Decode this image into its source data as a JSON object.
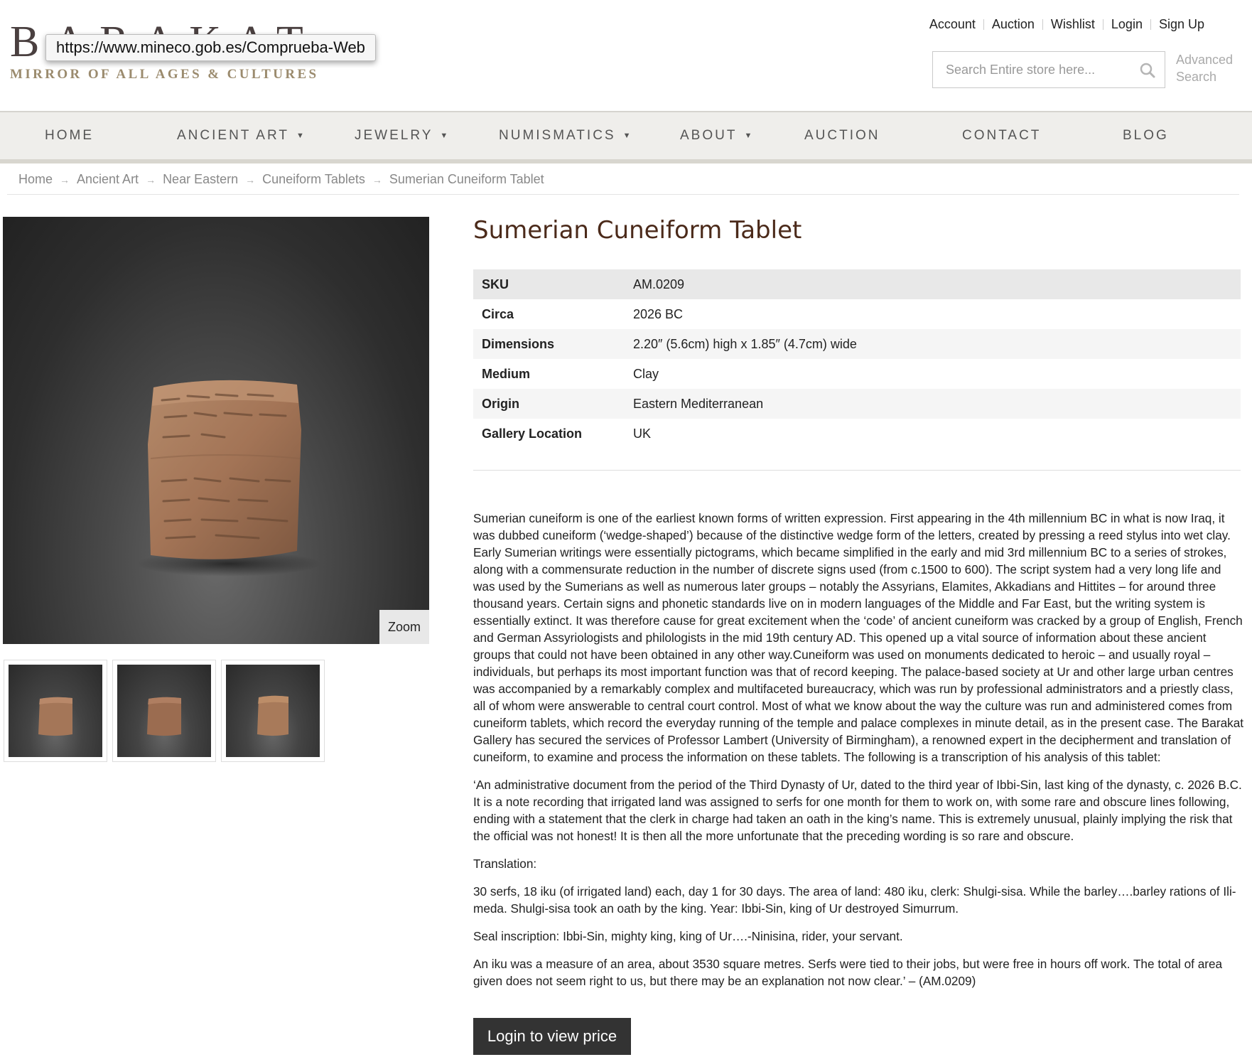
{
  "brand": {
    "name": "BARAKAT",
    "tagline": "MIRROR OF ALL AGES & CULTURES"
  },
  "url_tooltip": "https://www.mineco.gob.es/Comprueba-Web",
  "top_links": [
    "Account",
    "Auction",
    "Wishlist",
    "Login",
    "Sign Up"
  ],
  "search": {
    "placeholder": "Search Entire store here...",
    "advanced_line1": "Advanced",
    "advanced_line2": "Search"
  },
  "nav": [
    {
      "label": "HOME",
      "dropdown": false
    },
    {
      "label": "ANCIENT ART",
      "dropdown": true
    },
    {
      "label": "JEWELRY",
      "dropdown": true
    },
    {
      "label": "NUMISMATICS",
      "dropdown": true
    },
    {
      "label": "ABOUT",
      "dropdown": true
    },
    {
      "label": "AUCTION",
      "dropdown": false
    },
    {
      "label": "CONTACT",
      "dropdown": false
    },
    {
      "label": "BLOG",
      "dropdown": false
    }
  ],
  "breadcrumb": [
    "Home",
    "Ancient Art",
    "Near Eastern",
    "Cuneiform Tablets",
    "Sumerian Cuneiform Tablet"
  ],
  "gallery": {
    "zoom_label": "Zoom",
    "thumbnail_count": 3
  },
  "product": {
    "title": "Sumerian Cuneiform Tablet",
    "attributes": [
      {
        "key": "SKU",
        "value": "AM.0209"
      },
      {
        "key": "Circa",
        "value": "2026 BC"
      },
      {
        "key": "Dimensions",
        "value": "2.20″ (5.6cm) high x 1.85″ (4.7cm) wide"
      },
      {
        "key": "Medium",
        "value": "Clay"
      },
      {
        "key": "Origin",
        "value": "Eastern Mediterranean"
      },
      {
        "key": "Gallery Location",
        "value": "UK"
      }
    ],
    "description": [
      "Sumerian cuneiform is one of the earliest known forms of written expression. First appearing in the 4th millennium BC in what is now Iraq, it was dubbed cuneiform (‘wedge-shaped’) because of the distinctive wedge form of the letters, created by pressing a reed stylus into wet clay. Early Sumerian writings were essentially pictograms, which became simplified in the early and mid 3rd millennium BC to a series of strokes, along with a commensurate reduction in the number of discrete signs used (from c.1500 to 600). The script system had a very long life and was used by the Sumerians as well as numerous later groups – notably the Assyrians, Elamites, Akkadians and Hittites – for around three thousand years. Certain signs and phonetic standards live on in modern languages of the Middle and Far East, but the writing system is essentially extinct. It was therefore cause for great excitement when the ‘code’ of ancient cuneiform was cracked by a group of English, French and German Assyriologists and philologists in the mid 19th century AD. This opened up a vital source of information about these ancient groups that could not have been obtained in any other way.Cuneiform was used on monuments dedicated to heroic – and usually royal – individuals, but perhaps its most important function was that of record keeping. The palace-based society at Ur and other large urban centres was accompanied by a remarkably complex and multifaceted bureaucracy, which was run by professional administrators and a priestly class, all of whom were answerable to central court control. Most of what we know about the way the culture was run and administered comes from cuneiform tablets, which record the everyday running of the temple and palace complexes in minute detail, as in the present case. The Barakat Gallery has secured the services of Professor Lambert (University of Birmingham), a renowned expert in the decipherment and translation of cuneiform, to examine and process the information on these tablets. The following is a transcription of his analysis of this tablet:",
      "‘An administrative document from the period of the Third Dynasty of Ur, dated to the third year of Ibbi-Sin, last king of the dynasty, c. 2026 B.C. It is a note recording that irrigated land was assigned to serfs for one month for them to work on, with some rare and obscure lines following, ending with a statement that the clerk in charge had taken an oath in the king’s name. This is extremely unusual, plainly implying the risk that the official was not honest! It is then all the more unfortunate that the preceding wording is so rare and obscure.",
      "Translation:",
      "30 serfs, 18 iku (of irrigated land) each, day 1 for 30 days. The area of land: 480 iku, clerk: Shulgi-sisa. While the barley….barley rations of Ili-meda. Shulgi-sisa took an oath by the king. Year: Ibbi-Sin, king of Ur destroyed Simurrum.",
      "Seal inscription: Ibbi-Sin, mighty king, king of Ur….-Ninisina, rider, your servant.",
      "An iku was a measure of an area, about 3530 square metres. Serfs were tied to their jobs, but were free in hours off work. The total of area given does not seem right to us, but there may be an explanation not now clear.’ – (AM.0209)"
    ],
    "login_button": "Login to view price"
  },
  "colors": {
    "title": "#4b2a1a",
    "nav_bg": "#efeeeb",
    "button_bg": "#333333",
    "logo_tagline": "#9b8b6e"
  }
}
